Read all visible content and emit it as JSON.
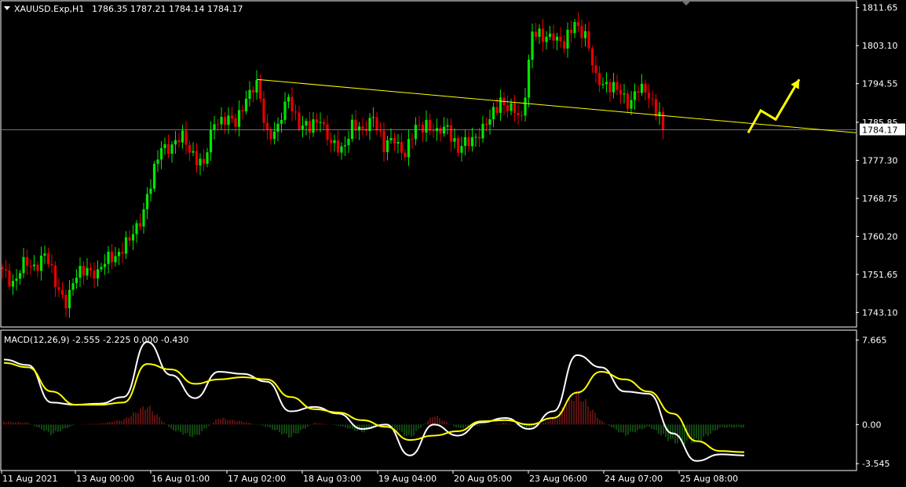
{
  "header": {
    "symbol": "XAUUSD.Exp,H1",
    "ohlc": "1786.35 1787.21 1784.14 1784.17"
  },
  "macd_header": {
    "label": "MACD(12,26,9) -2.555 -2.225 0.000 -0.430"
  },
  "colors": {
    "background": "#000000",
    "axis": "#ffffff",
    "bull_candle": "#00e600",
    "bear_candle": "#e60000",
    "trendline": "#ffff00",
    "arrow": "#ffff00",
    "macd_line": "#ffffff",
    "signal_line": "#ffff00",
    "hist_positive": "#b22222",
    "hist_negative": "#228b22",
    "current_price_line": "#8899aa"
  },
  "chart_data": [
    {
      "type": "candlestick",
      "series_name": "XAUUSD.Exp",
      "timeframe": "H1",
      "ylim": [
        1740,
        1813
      ],
      "yticks": [
        "1811.65",
        "1803.10",
        "1794.55",
        "1785.85",
        "1777.30",
        "1768.75",
        "1760.20",
        "1751.65",
        "1743.10"
      ],
      "current_price": "1784.17",
      "close_path": [
        1752,
        1750,
        1754,
        1753,
        1757,
        1749,
        1746,
        1751,
        1753,
        1752,
        1755,
        1757,
        1759,
        1764,
        1772,
        1780,
        1781,
        1782,
        1779,
        1776,
        1786,
        1787,
        1785,
        1792,
        1794,
        1783,
        1785,
        1791,
        1786,
        1784,
        1787,
        1781,
        1779,
        1786,
        1783,
        1788,
        1780,
        1782,
        1779,
        1784,
        1786,
        1783,
        1785,
        1780,
        1781,
        1784,
        1786,
        1791,
        1789,
        1786,
        1807,
        1804,
        1806,
        1803,
        1808,
        1806,
        1795,
        1795,
        1793,
        1790,
        1794,
        1791,
        1788
      ],
      "trendline": {
        "start": [
          "17 Aug 02:00",
          1795.5
        ],
        "end": [
          "25 Aug 18:00",
          1783.5
        ]
      },
      "forecast_arrow_prices": [
        1783.5,
        1788.5,
        1786.5,
        1795.5
      ],
      "xticks": [
        "11 Aug 2021",
        "13 Aug 00:00",
        "16 Aug 01:00",
        "17 Aug 02:00",
        "18 Aug 03:00",
        "19 Aug 04:00",
        "20 Aug 05:00",
        "23 Aug 06:00",
        "24 Aug 07:00",
        "25 Aug 08:00"
      ]
    },
    {
      "type": "line",
      "series_name": "MACD(12,26,9)",
      "ylim": [
        -4.1,
        8.5
      ],
      "yticks": [
        "7.665",
        "0.00",
        "-3.545"
      ],
      "series": [
        {
          "name": "MACD",
          "values": [
            5.9,
            5.4,
            2.0,
            1.8,
            1.9,
            2.5,
            7.5,
            4.5,
            2.4,
            4.8,
            4.6,
            3.9,
            1.2,
            1.6,
            1.0,
            -0.4,
            0.0,
            -2.8,
            0.0,
            -1.0,
            0.2,
            0.6,
            -0.4,
            1.2,
            6.3,
            5.2,
            3.0,
            2.8,
            -0.8,
            -3.3,
            -2.7,
            -2.8
          ]
        },
        {
          "name": "Signal",
          "values": [
            5.6,
            5.2,
            3.0,
            1.8,
            1.8,
            2.0,
            5.5,
            5.0,
            3.7,
            4.1,
            4.3,
            4.1,
            2.5,
            1.4,
            1.1,
            0.4,
            -0.2,
            -1.4,
            -1.0,
            -0.6,
            0.3,
            0.4,
            0.0,
            0.6,
            2.9,
            4.8,
            4.1,
            3.0,
            1.0,
            -1.5,
            -2.4,
            -2.5
          ]
        }
      ],
      "histogram": [
        0.3,
        0.2,
        -1.0,
        0.0,
        0.1,
        0.5,
        2.0,
        -0.5,
        -1.3,
        0.7,
        0.3,
        -0.2,
        -1.3,
        0.2,
        -0.1,
        -0.8,
        0.2,
        -1.4,
        1.0,
        -0.4,
        -0.1,
        0.2,
        -0.4,
        0.6,
        3.4,
        0.4,
        -1.1,
        -0.2,
        -1.8,
        -1.8,
        -0.3,
        -0.3
      ]
    }
  ]
}
